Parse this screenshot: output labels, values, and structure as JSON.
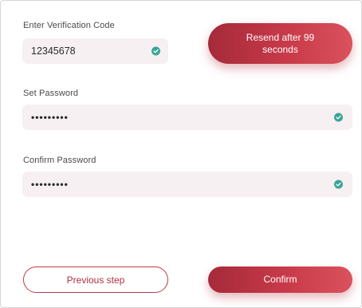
{
  "verification": {
    "label": "Enter Verification Code",
    "value": "12345678",
    "resend_label": "Resend after 99 seconds"
  },
  "password": {
    "label": "Set Password",
    "value": "•••••••••"
  },
  "confirm_password": {
    "label": "Confirm Password",
    "value": "•••••••••"
  },
  "actions": {
    "previous_label": "Previous step",
    "confirm_label": "Confirm"
  },
  "colors": {
    "accent": "#c93a49",
    "field_bg": "#f6f0f2",
    "check": "#3aa597"
  }
}
